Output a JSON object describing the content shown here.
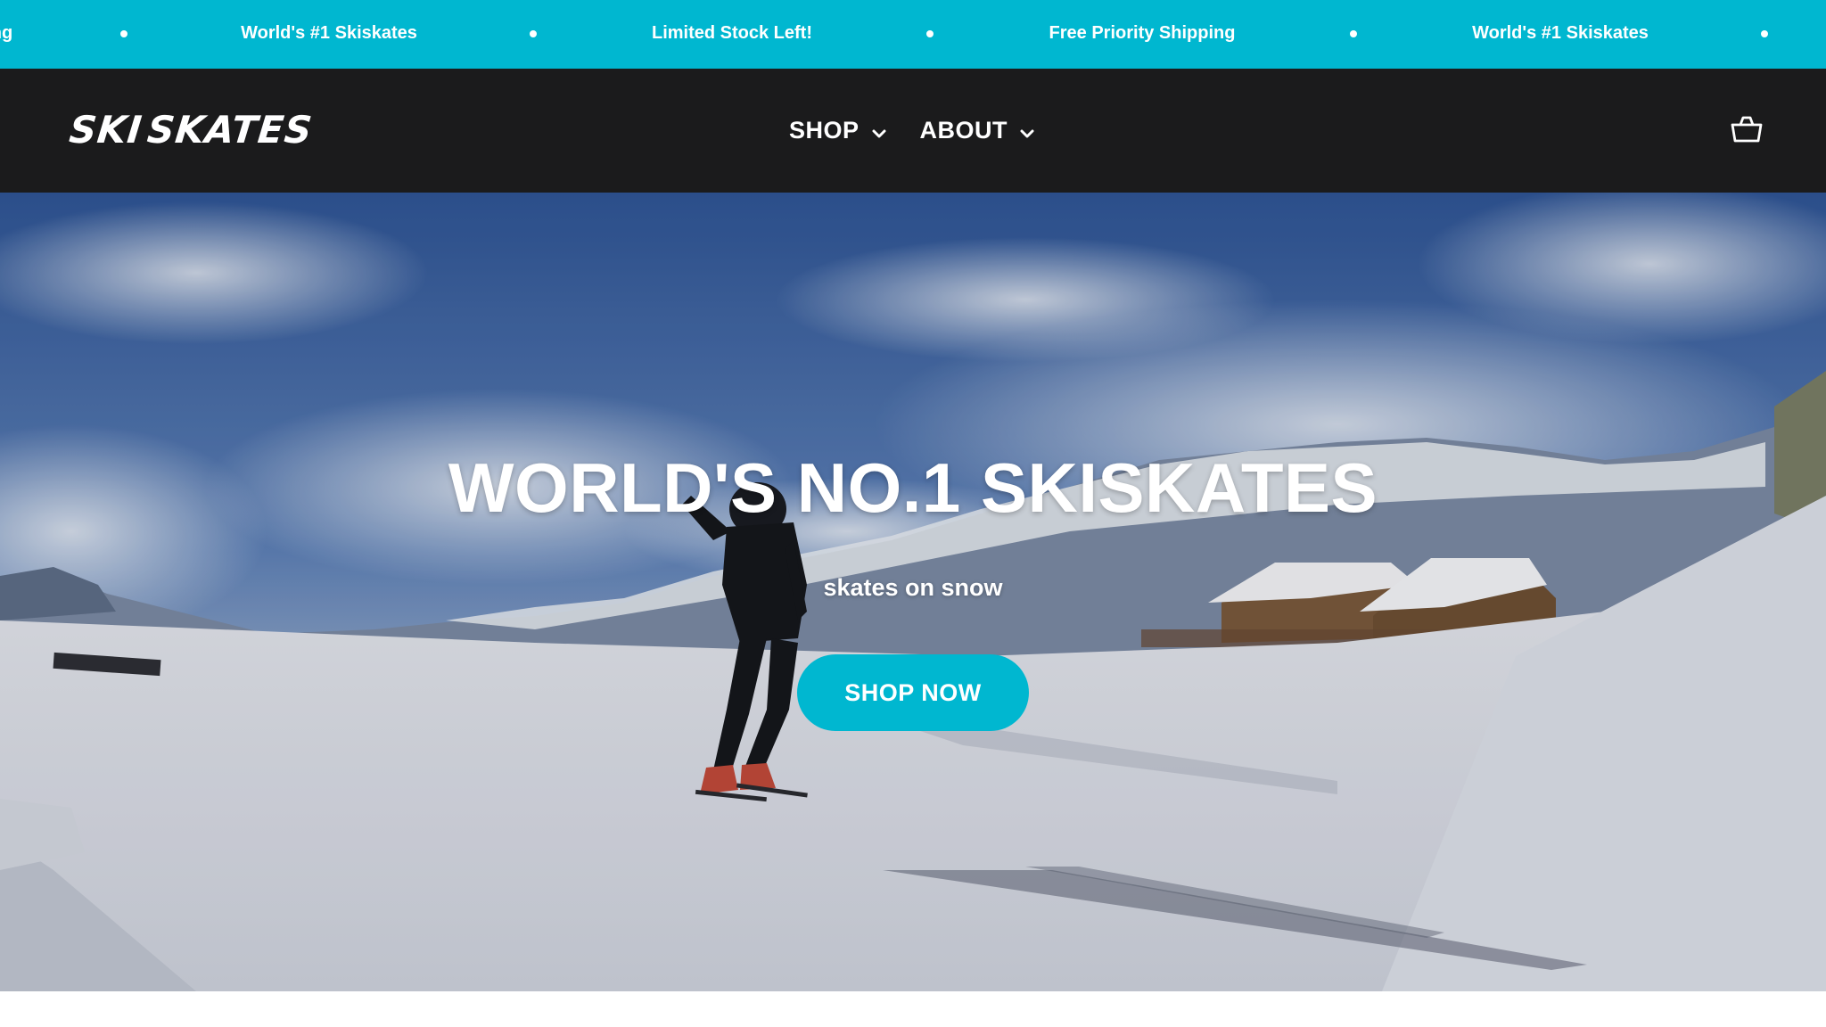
{
  "announcement": {
    "background_color": "#00b7d0",
    "messages": [
      "ng",
      "World's #1 Skiskates",
      "Limited Stock Left!",
      "Free Priority Shipping",
      "World's #1 Skiskates"
    ]
  },
  "header": {
    "background_color": "#1b1b1c",
    "logo_left": "SKI",
    "logo_right": "SKATES",
    "nav": [
      {
        "label": "SHOP",
        "icon": "chevron-down-icon"
      },
      {
        "label": "ABOUT",
        "icon": "chevron-down-icon"
      }
    ],
    "cart_icon": "shopping-basket-icon"
  },
  "hero": {
    "title": "WORLD'S NO.1 SKISKATES",
    "subtitle": "skates on snow",
    "cta_label": "SHOP NOW",
    "cta_color": "#00b7d0"
  }
}
